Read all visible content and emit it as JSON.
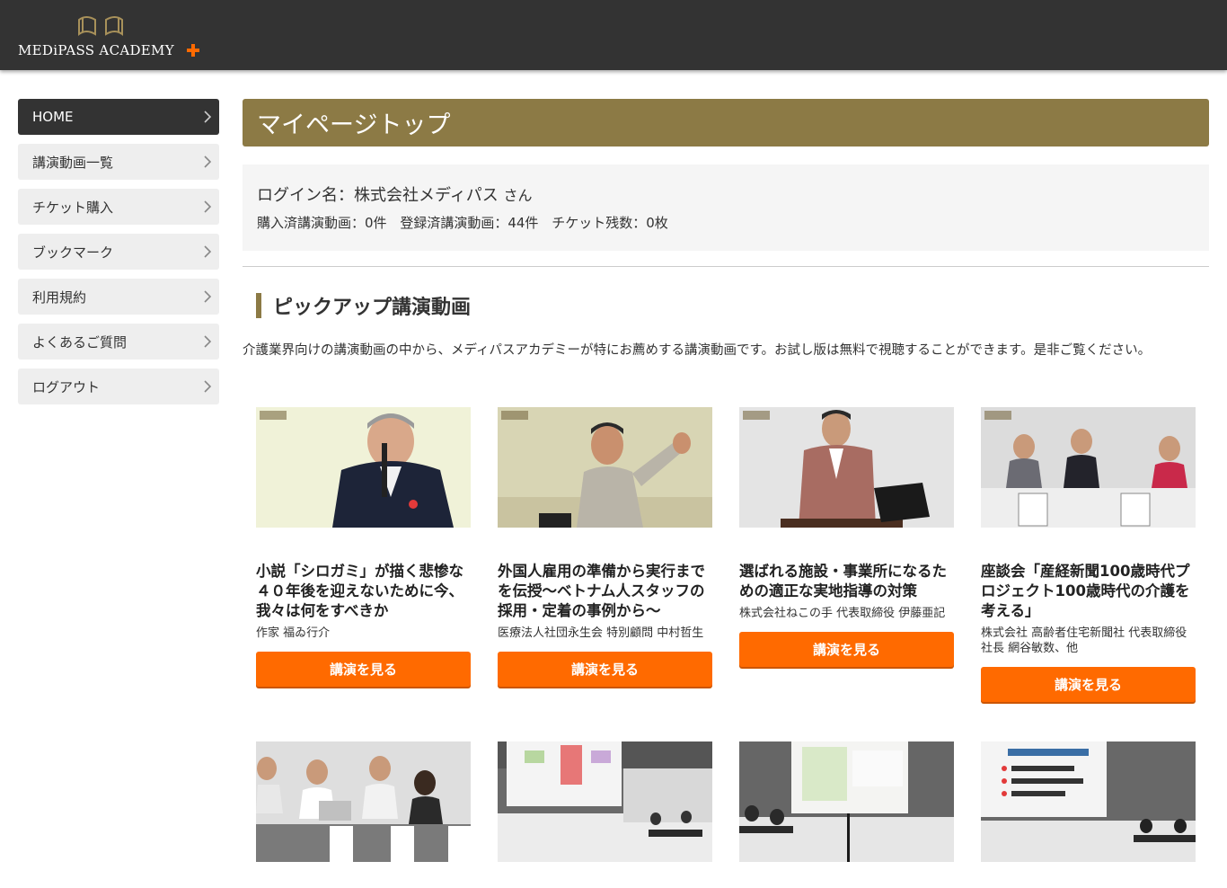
{
  "header": {
    "logo_text": "MEDiPASS ACADEMY",
    "accent_color": "#ff6a00",
    "gold_color": "#8c7a45"
  },
  "sidebar": {
    "items": [
      {
        "label": "HOME",
        "active": true
      },
      {
        "label": "講演動画一覧"
      },
      {
        "label": "チケット購入"
      },
      {
        "label": "ブックマーク"
      },
      {
        "label": "利用規約"
      },
      {
        "label": "よくあるご質問"
      },
      {
        "label": "ログアウト"
      }
    ]
  },
  "main": {
    "title": "マイページトップ",
    "login_label": "ログイン名：株式会社メディパス",
    "login_suffix": "さん",
    "purchased": "購入済講演動画：0件",
    "registered": "登録済講演動画：44件",
    "tickets": "チケット残数：0枚",
    "pickup_title": "ピックアップ講演動画",
    "pickup_desc": "介護業界向けの講演動画の中から、メディパスアカデミーが特にお薦めする講演動画です。お試し版は無料で視聴することができます。是非ご覧ください。"
  },
  "cards": [
    {
      "title": "小説「シロガミ」が描く悲惨な４０年後を迎えないために今、我々は何をすべきか",
      "speaker": "作家 福ゐ行介",
      "button": "講演を見る"
    },
    {
      "title": "外国人雇用の準備から実行までを伝授～ベトナム人スタッフの採用・定着の事例から～",
      "speaker": "医療法人社団永生会 特別顧問 中村哲生",
      "button": "講演を見る"
    },
    {
      "title": "選ばれる施設・事業所になるための適正な実地指導の対策",
      "speaker": "株式会社ねこの手 代表取締役 伊藤亜記",
      "button": "講演を見る"
    },
    {
      "title": "座談会「産経新聞100歳時代プロジェクト100歳時代の介護を考える」",
      "speaker": "株式会社 高齢者住宅新聞社 代表取締役社長 網谷敏数、他",
      "button": "講演を見る"
    }
  ]
}
